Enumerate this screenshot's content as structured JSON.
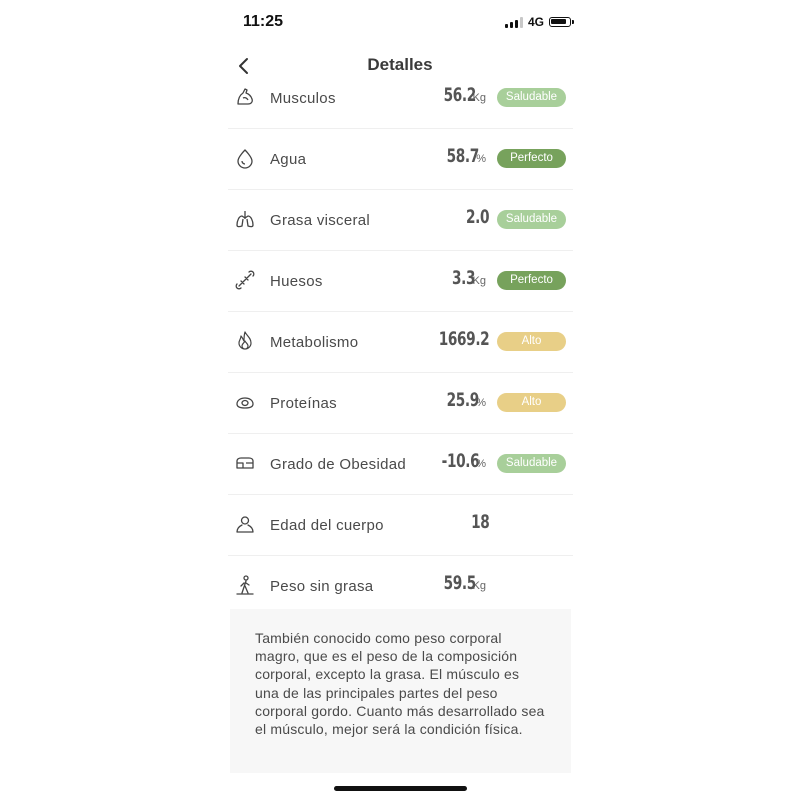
{
  "status": {
    "time": "11:25",
    "network": "4G"
  },
  "nav": {
    "title": "Detalles"
  },
  "rows": [
    {
      "label": "Musculos",
      "value": "56.2",
      "unit": "Kg",
      "badge": "Saludable",
      "icon": "flexed-arm-icon"
    },
    {
      "label": "Agua",
      "value": "58.7",
      "unit": "%",
      "badge": "Perfecto",
      "icon": "water-drop-icon"
    },
    {
      "label": "Grasa visceral",
      "value": "2.0",
      "unit": "",
      "badge": "Saludable",
      "icon": "lungs-icon"
    },
    {
      "label": "Huesos",
      "value": "3.3",
      "unit": "Kg",
      "badge": "Perfecto",
      "icon": "bone-icon"
    },
    {
      "label": "Metabolismo",
      "value": "1669.2",
      "unit": "",
      "badge": "Alto",
      "icon": "flame-icon"
    },
    {
      "label": "Proteínas",
      "value": "25.9",
      "unit": "%",
      "badge": "Alto",
      "icon": "egg-icon"
    },
    {
      "label": "Grado de Obesidad",
      "value": "-10.6",
      "unit": "%",
      "badge": "Saludable",
      "icon": "body-fat-icon"
    },
    {
      "label": "Edad del cuerpo",
      "value": "18",
      "unit": "",
      "badge": "",
      "icon": "person-icon"
    },
    {
      "label": "Peso sin grasa",
      "value": "59.5",
      "unit": "Kg",
      "badge": "",
      "icon": "standing-figure-icon"
    }
  ],
  "description": "También conocido como peso corporal magro, que es el peso de la composición corporal, excepto la grasa. El músculo es una de las principales partes del peso corporal gordo. Cuanto más desarrollado sea el músculo, mejor será la condición física.",
  "colors": {
    "saludable": "#a8cf9a",
    "perfecto": "#77a25c",
    "alto": "#e8cf87"
  }
}
